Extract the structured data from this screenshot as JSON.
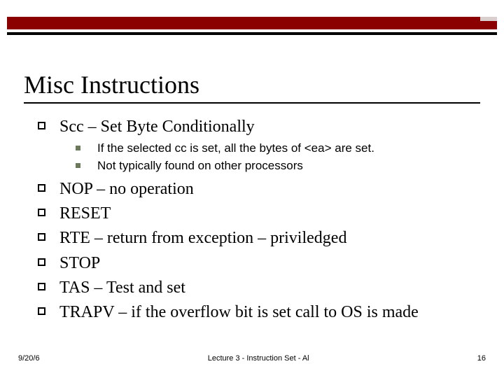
{
  "title": "Misc Instructions",
  "items": [
    {
      "text": "Scc – Set Byte Conditionally",
      "sub": [
        "If the selected cc is set, all the bytes of  <ea> are set.",
        "Not typically found on other processors"
      ]
    },
    {
      "text": "NOP – no operation"
    },
    {
      "text": "RESET"
    },
    {
      "text": "RTE – return from exception – priviledged"
    },
    {
      "text": "STOP"
    },
    {
      "text": "TAS – Test and set"
    },
    {
      "text": "TRAPV – if the overflow bit is set call to OS is made"
    }
  ],
  "footer": {
    "left": "9/20/6",
    "center": "Lecture 3 - Instruction Set - Al",
    "right": "16"
  }
}
